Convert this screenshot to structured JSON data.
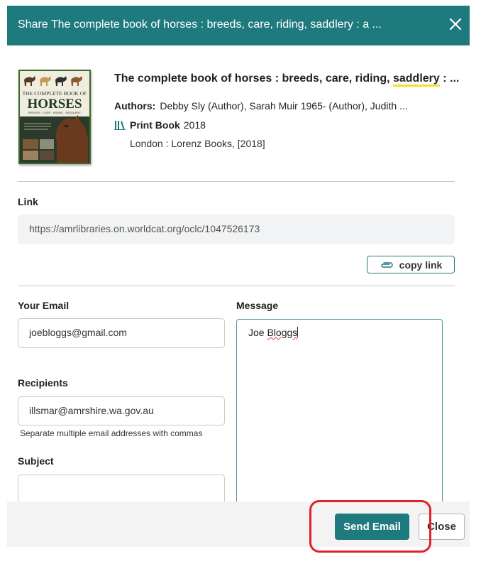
{
  "header": {
    "title": "Share The complete book of horses : breeds, care, riding, saddlery : a ..."
  },
  "book": {
    "cover_text": {
      "line1": "THE COMPLETE BOOK OF",
      "line2": "HORSES",
      "line3": "BREEDS · CARE · RIDING · SADDLERY"
    },
    "title_before": "The complete book of horses : breeds, care, riding, ",
    "title_highlight": "saddlery",
    "title_after": " : ...",
    "authors_label": "Authors:",
    "authors_value": "Debby Sly (Author), Sarah Muir 1965- (Author), Judith ...",
    "format_label": "Print Book",
    "year": "2018",
    "publisher": "London : Lorenz Books, [2018]"
  },
  "link": {
    "label": "Link",
    "url": "https://amrlibraries.on.worldcat.org/oclc/1047526173",
    "copy_label": "copy link"
  },
  "form": {
    "your_email_label": "Your Email",
    "your_email_value": "joebloggs@gmail.com",
    "recipients_label": "Recipients",
    "recipients_value": "illsmar@amrshire.wa.gov.au",
    "recipients_help": "Separate multiple email addresses with commas",
    "subject_label": "Subject",
    "subject_value": "",
    "message_label": "Message",
    "message_first": "Joe ",
    "message_second": "Bloggs"
  },
  "footer": {
    "send_label": "Send Email",
    "close_label": "Close"
  },
  "colors": {
    "accent": "#1f7a7e",
    "highlight_box": "#e0202a",
    "title_underline": "#f5dd2e"
  }
}
